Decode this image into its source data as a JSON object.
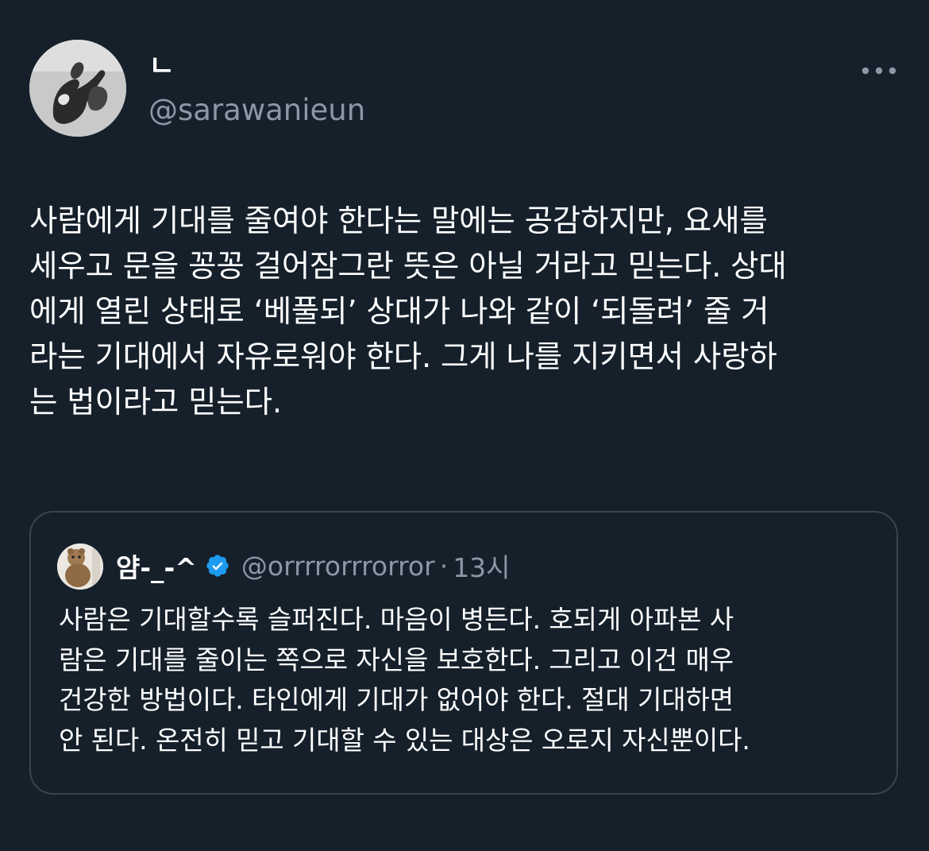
{
  "tweet": {
    "display_name": "ㄴ",
    "handle": "@sarawanieun",
    "text_lines": [
      "사람에게 기대를 줄여야 한다는 말에는 공감하지만, 요새를",
      "세우고 문을 꽁꽁 걸어잠그란 뜻은 아닐 거라고 믿는다. 상대",
      "에게 열린 상태로 ‘베풀되’ 상대가 나와 같이 ‘되돌려’ 줄 거",
      "라는 기대에서 자유로워야 한다. 그게 나를 지키면서 사랑하",
      "는 법이라고 믿는다."
    ],
    "more_icon": "more-horizontal-icon"
  },
  "quote": {
    "display_name": "얌-_-^",
    "verified_icon": "verified-badge-icon",
    "handle": "@orrrrorrrorror",
    "separator": "·",
    "time": "13시",
    "text_lines": [
      "사람은 기대할수록 슬퍼진다. 마음이 병든다. 호되게 아파본 사",
      "람은 기대를 줄이는 쪽으로 자신을 보호한다. 그리고 이건 매우",
      "건강한 방법이다. 타인에게 기대가 없어야 한다. 절대 기대하면",
      "안 된다. 온전히 믿고 기대할 수 있는 대상은 오로지 자신뿐이다."
    ]
  },
  "colors": {
    "background": "#15202b",
    "text_primary": "#ffffff",
    "text_secondary": "#8b98a5",
    "border": "#38444d",
    "verified": "#1d9bf0"
  }
}
